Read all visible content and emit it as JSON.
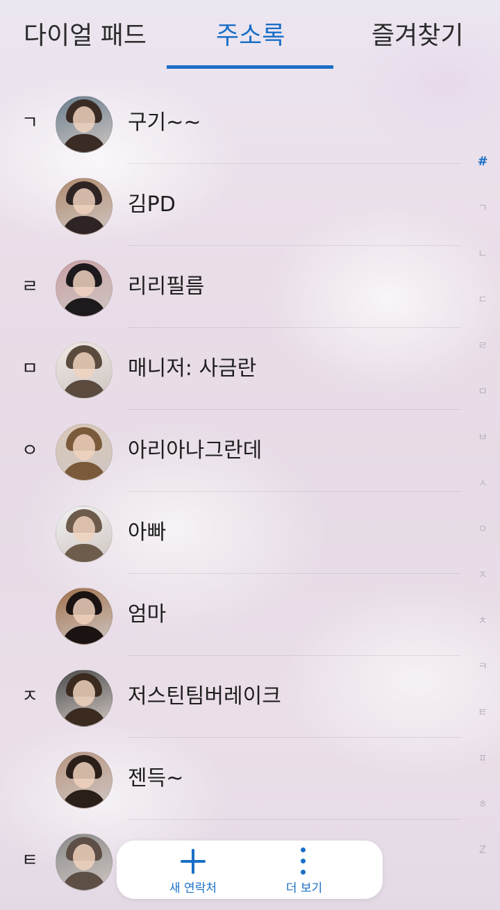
{
  "tabs": [
    {
      "label": "다이얼 패드"
    },
    {
      "label": "주소록"
    },
    {
      "label": "즐겨찾기"
    }
  ],
  "active_tab": "주소록",
  "contacts": [
    {
      "letter": "ㄱ",
      "name": "구기~~"
    },
    {
      "letter": "",
      "name": "김PD"
    },
    {
      "letter": "ㄹ",
      "name": "리리필름"
    },
    {
      "letter": "ㅁ",
      "name": "매니저: 사금란"
    },
    {
      "letter": "ㅇ",
      "name": "아리아나그란데"
    },
    {
      "letter": "",
      "name": "아빠"
    },
    {
      "letter": "",
      "name": "엄마"
    },
    {
      "letter": "ㅈ",
      "name": "저스틴팀버레이크"
    },
    {
      "letter": "",
      "name": "젠득~"
    },
    {
      "letter": "ㅌ",
      "name": ""
    }
  ],
  "index_letters": [
    "#",
    "ㄱ",
    "ㄴ",
    "ㄷ",
    "ㄹ",
    "ㅁ",
    "ㅂ",
    "ㅅ",
    "ㅇ",
    "ㅈ",
    "ㅊ",
    "ㅋ",
    "ㅌ",
    "ㅍ",
    "ㅎ",
    "Z"
  ],
  "active_index": "#",
  "bottom_bar": {
    "new_contact_label": "새 연락처",
    "new_contact_icon": "plus-icon",
    "more_label": "더 보기",
    "more_icon": "more-vertical-icon"
  },
  "colors": {
    "accent": "#1a6fc7",
    "text": "#1e1e1e"
  }
}
